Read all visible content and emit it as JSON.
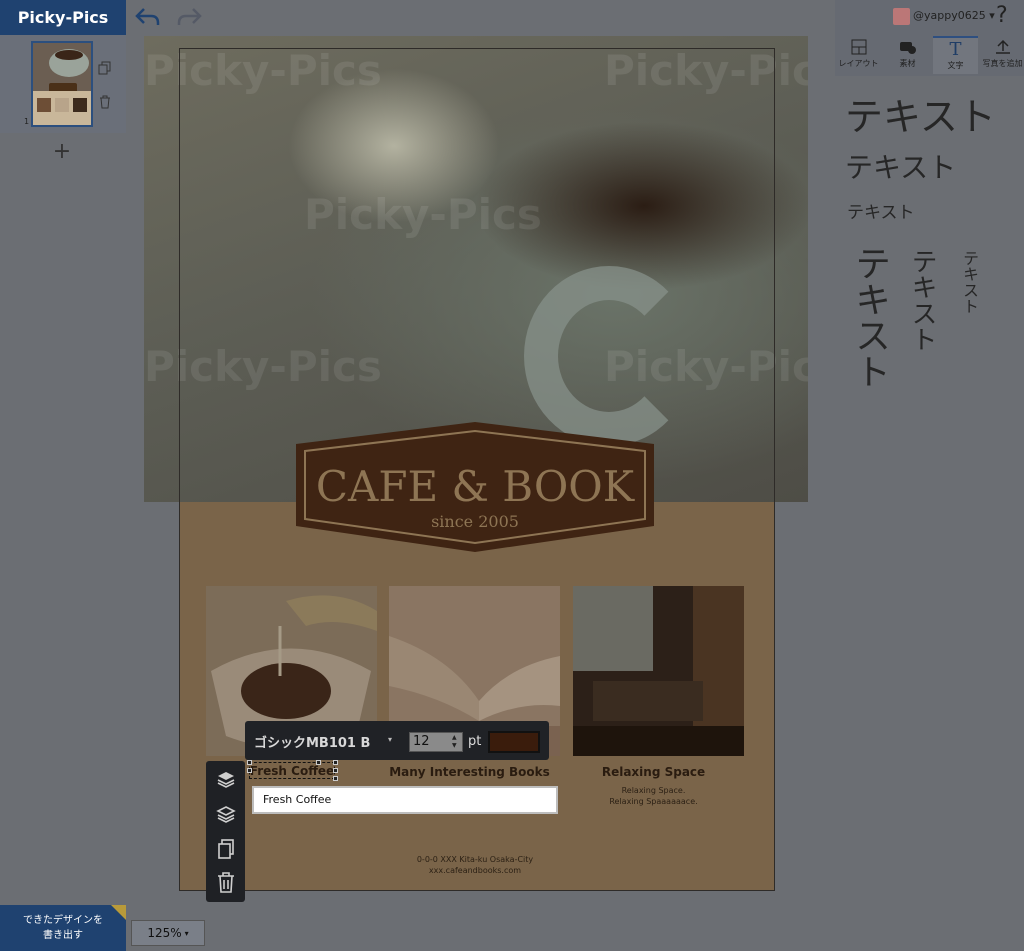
{
  "app": {
    "logo": "Picky-Pics"
  },
  "icons": {
    "undo": "undo-icon",
    "redo": "redo-icon"
  },
  "pages": {
    "thumbnail_number": "1",
    "add_symbol": "+"
  },
  "poster": {
    "watermark": "Picky-Pics",
    "badge_title": "CAFE & BOOK",
    "badge_subtitle": "since 2005",
    "columns": [
      {
        "title": "Fresh Coffee",
        "desc": [
          "",
          ""
        ]
      },
      {
        "title": "Many Interesting Books",
        "desc": [
          "",
          ""
        ]
      },
      {
        "title": "Relaxing Space",
        "desc": [
          "Relaxing Space.",
          "Relaxing Spaaaaaace."
        ]
      }
    ],
    "address": [
      "0-0-0 XXX Kita-ku Osaka-City",
      "xxx.cafeandbooks.com"
    ]
  },
  "format_toolbar": {
    "font": "ゴシックMB101 B",
    "font_arrow": "▾",
    "size": "12",
    "unit": "pt",
    "color": "#3a1c0c"
  },
  "text_editor": {
    "value": "Fresh Coffee"
  },
  "header": {
    "username": "@yappy0625",
    "username_arrow": "▾",
    "help": "?"
  },
  "right_tabs": [
    {
      "label": "レイアウト",
      "icon": "layout-icon"
    },
    {
      "label": "素材",
      "icon": "material-icon"
    },
    {
      "label": "文字",
      "icon": "text-icon"
    },
    {
      "label": "写真を追加",
      "icon": "upload-icon"
    }
  ],
  "text_samples": [
    "テキスト",
    "テキスト",
    "テキスト",
    "テキスト",
    "テキスト",
    "テキスト"
  ],
  "footer": {
    "export_label": [
      "できたデザインを",
      "書き出す"
    ],
    "zoom": "125%",
    "zoom_arrow": "▾"
  }
}
